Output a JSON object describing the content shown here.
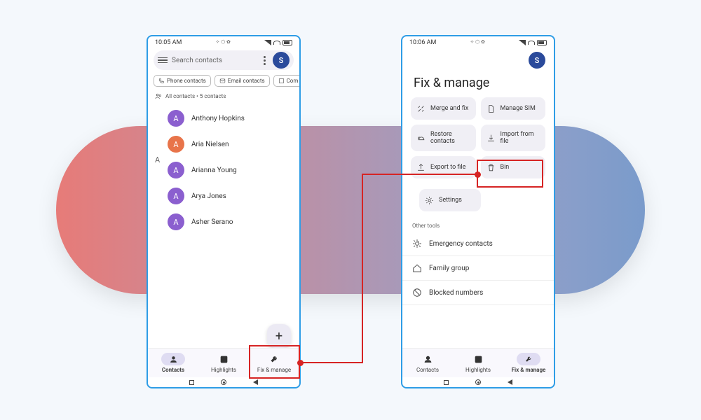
{
  "avatarLetter": "S",
  "searchPlaceholder": "Search contacts",
  "phone1": {
    "time": "10:05 AM",
    "statusIcons": "✧ ⬡ ✿",
    "chips": [
      "Phone contacts",
      "Email contacts",
      "Com"
    ],
    "summary": "All contacts • 5 contacts",
    "sectionLetter": "A",
    "contacts": [
      {
        "letter": "A",
        "name": "Anthony Hopkins",
        "color": "purple"
      },
      {
        "letter": "A",
        "name": "Aria Nielsen",
        "color": "orange"
      },
      {
        "letter": "A",
        "name": "Arianna Young",
        "color": "purple"
      },
      {
        "letter": "A",
        "name": "Arya Jones",
        "color": "purple"
      },
      {
        "letter": "A",
        "name": "Asher Serano",
        "color": "purple"
      }
    ],
    "fab": "+",
    "nav": [
      "Contacts",
      "Highlights",
      "Fix & manage"
    ]
  },
  "phone2": {
    "time": "10:06 AM",
    "statusIcons": "✧ ⬡ ✿",
    "title": "Fix & manage",
    "tiles": [
      "Merge and fix",
      "Manage SIM",
      "Restore contacts",
      "Import from file",
      "Export to file",
      "Bin"
    ],
    "settingsTile": "Settings",
    "otherTitle": "Other tools",
    "otherRows": [
      "Emergency contacts",
      "Family group",
      "Blocked numbers"
    ],
    "nav": [
      "Contacts",
      "Highlights",
      "Fix & manage"
    ]
  }
}
